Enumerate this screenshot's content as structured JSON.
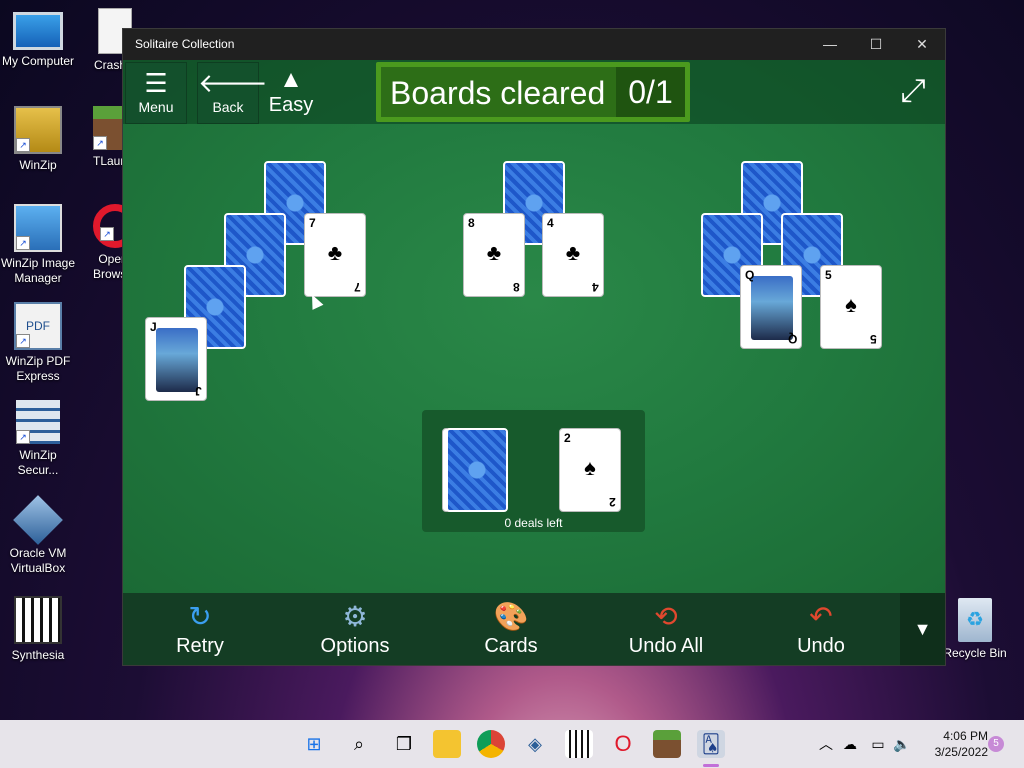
{
  "desktop": {
    "icons": [
      {
        "label": "My Computer"
      },
      {
        "label": "Crash..."
      },
      {
        "label": "WinZip"
      },
      {
        "label": "TLaun..."
      },
      {
        "label": "WinZip Image Manager"
      },
      {
        "label": "Opera Browser"
      },
      {
        "label": "WinZip PDF Express"
      },
      {
        "label": "WinZip Secur..."
      },
      {
        "label": "Oracle VM VirtualBox"
      },
      {
        "label": "Synthesia"
      },
      {
        "label": "Recycle Bin"
      }
    ]
  },
  "window": {
    "title": "Solitaire Collection",
    "minimize": "—",
    "maximize": "☐",
    "close": "✕"
  },
  "toolbar": {
    "menu_label": "Menu",
    "back_label": "Back",
    "difficulty_label": "Easy",
    "score_label": "Boards cleared",
    "score_value": "0/1"
  },
  "board": {
    "cards": [
      {
        "rank": "7",
        "suit": "♣"
      },
      {
        "rank": "8",
        "suit": "♣"
      },
      {
        "rank": "4",
        "suit": "♣"
      },
      {
        "rank": "Q",
        "suit": "♠"
      },
      {
        "rank": "5",
        "suit": "♠"
      },
      {
        "rank": "J",
        "suit": "♠"
      }
    ],
    "waste_card": {
      "rank": "2",
      "suit": "♠"
    },
    "deals_left": "0 deals left"
  },
  "bottom_bar": {
    "retry": "Retry",
    "options": "Options",
    "cards": "Cards",
    "undo_all": "Undo All",
    "undo": "Undo"
  },
  "taskbar": {
    "time": "4:06 PM",
    "date": "3/25/2022",
    "notification_count": "5"
  },
  "colors": {
    "felt": "#217a3f",
    "score_bg": "#4b9a1e",
    "bottom_bar": "#143d24"
  }
}
